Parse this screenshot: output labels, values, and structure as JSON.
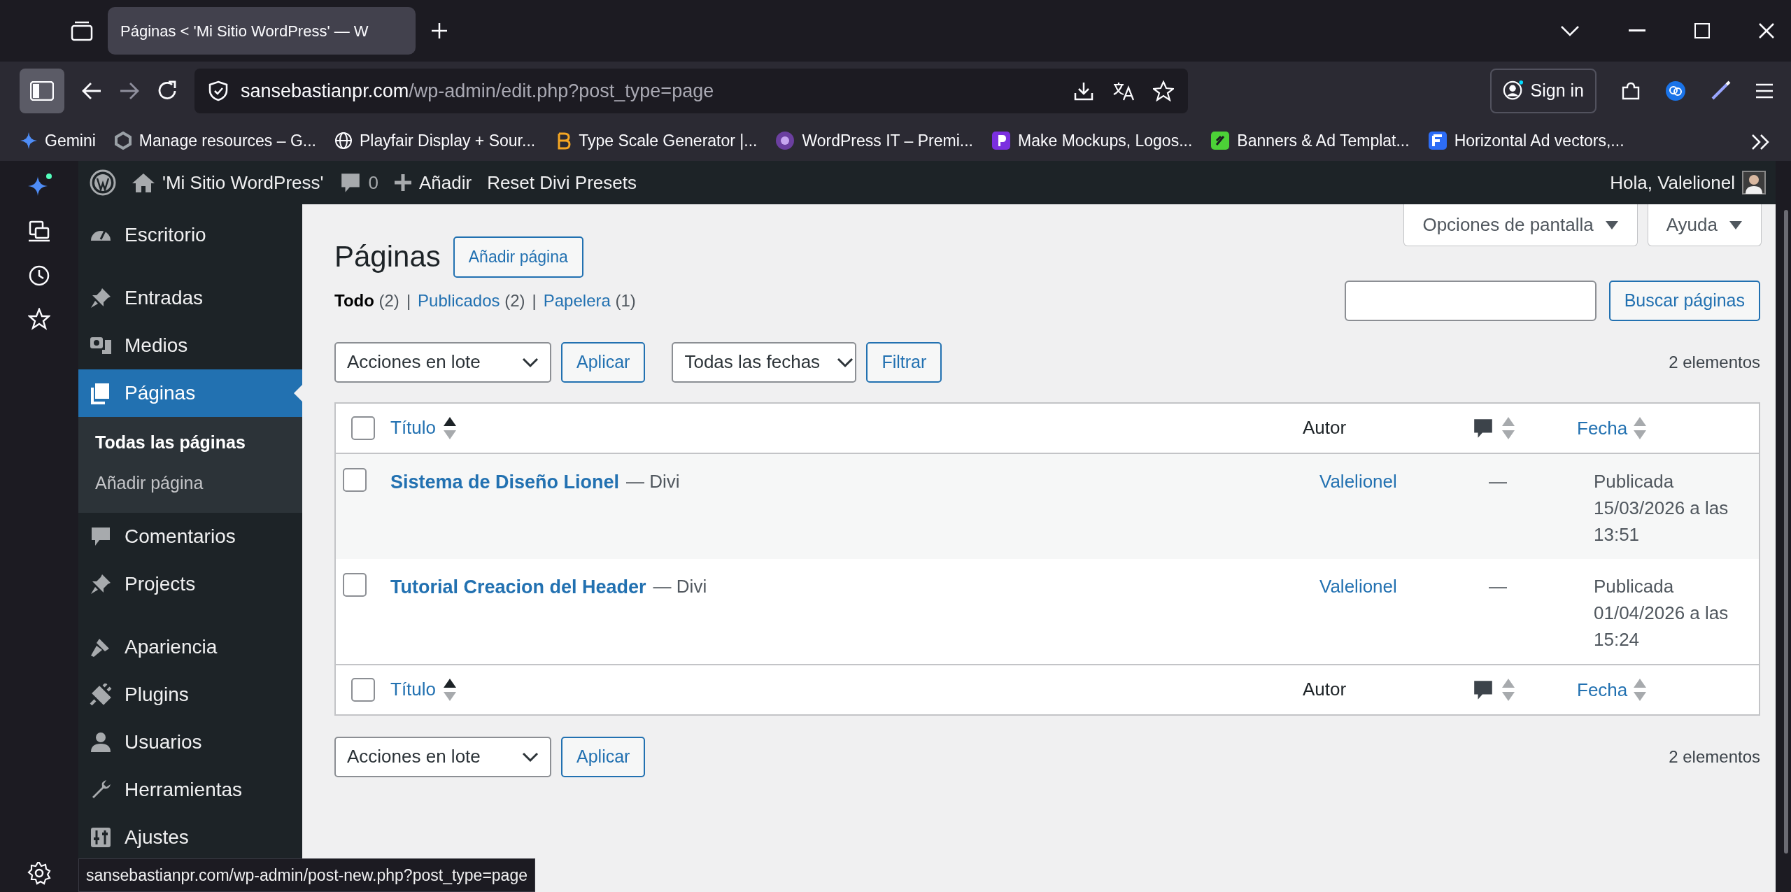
{
  "browser": {
    "tabs": [
      {
        "title": "Páginas < 'Mi Sitio WordPress' — W",
        "selected": true
      }
    ],
    "url": {
      "host": "sansebastianpr.com",
      "path": "/wp-admin/edit.php?post_type=page"
    },
    "sign_in": "Sign in",
    "bookmarks": [
      "Gemini",
      "Manage resources – G...",
      "Playfair Display + Sour...",
      "Type Scale Generator |...",
      "WordPress IT – Premi...",
      "Make Mockups, Logos...",
      "Banners & Ad Templat...",
      "Horizontal Ad vectors,..."
    ]
  },
  "admin_bar": {
    "site": "'Mi Sitio WordPress'",
    "comments": "0",
    "add": "Añadir",
    "custom": "Reset Divi Presets",
    "greeting": "Hola, Valelionel"
  },
  "sidebar": {
    "items": [
      {
        "label": "Escritorio",
        "selected": false
      },
      {
        "label": "Entradas",
        "selected": false
      },
      {
        "label": "Medios",
        "selected": false
      },
      {
        "label": "Páginas",
        "selected": true,
        "children": [
          {
            "label": "Todas las páginas",
            "selected": true
          },
          {
            "label": "Añadir página",
            "selected": false
          }
        ]
      },
      {
        "label": "Comentarios",
        "selected": false
      },
      {
        "label": "Projects",
        "selected": false
      },
      {
        "label": "Apariencia",
        "selected": false
      },
      {
        "label": "Plugins",
        "selected": false
      },
      {
        "label": "Usuarios",
        "selected": false
      },
      {
        "label": "Herramientas",
        "selected": false
      },
      {
        "label": "Ajustes",
        "selected": false
      }
    ]
  },
  "screen_meta": [
    "Opciones de pantalla",
    "Ayuda"
  ],
  "heading": "Páginas",
  "add_button": "Añadir página",
  "filters": [
    {
      "label": "Todo",
      "count": "(2)",
      "selected": true
    },
    {
      "separator": "|",
      "label": "Publicados",
      "count": "(2)",
      "selected": false
    },
    {
      "separator": "|",
      "label": "Papelera",
      "count": "(1)",
      "selected": false
    }
  ],
  "search_button": "Buscar páginas",
  "top_actions": {
    "bulk": "Acciones en lote",
    "apply": "Aplicar",
    "dates": "Todas las fechas",
    "filter": "Filtrar",
    "count": "2 elementos"
  },
  "table": {
    "select_all_checked": false,
    "columns": [
      "Título",
      "Autor",
      "Fecha"
    ],
    "rows": [
      {
        "title": "Sistema de Diseño Lionel",
        "suffix": "— Divi",
        "author": "Valelionel",
        "comments": "—",
        "status": "Publicada",
        "date": "15/03/2026 a las 13:51",
        "checked": false
      },
      {
        "title": "Tutorial Creacion del Header",
        "suffix": "— Divi",
        "author": "Valelionel",
        "comments": "—",
        "status": "Publicada",
        "date": "01/04/2026 a las 15:24",
        "checked": false
      }
    ],
    "footer_columns": [
      "Título",
      "Autor",
      "Fecha"
    ]
  },
  "bottom_actions": {
    "bulk": "Acciones en lote",
    "apply": "Aplicar",
    "count": "2 elementos"
  },
  "status_link": "sansebastianpr.com/wp-admin/post-new.php?post_type=page"
}
